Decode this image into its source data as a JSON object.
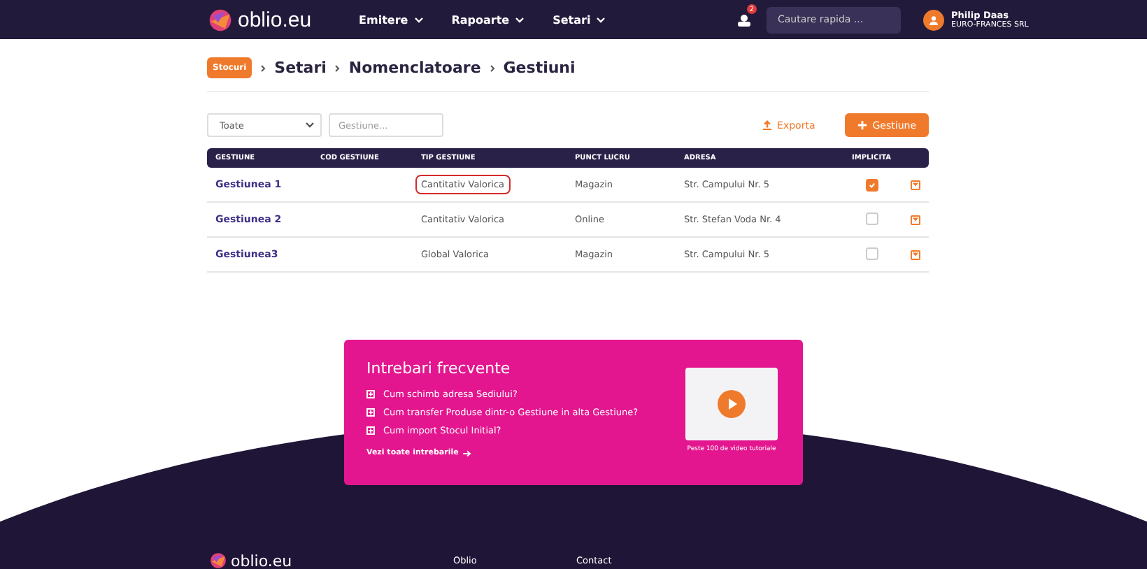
{
  "header": {
    "logo": "oblio.eu",
    "nav": [
      {
        "label": "Emitere"
      },
      {
        "label": "Rapoarte"
      },
      {
        "label": "Setari"
      }
    ],
    "notifications": "2",
    "search": {
      "placeholder": "Cautare rapida ..."
    },
    "user": {
      "name": "Philip Daas",
      "company": "EURO-FRANCES SRL"
    }
  },
  "breadcrumb": {
    "badge": "Stocuri",
    "items": [
      "Setari",
      "Nomenclatoare",
      "Gestiuni"
    ]
  },
  "toolbar": {
    "filter": "Toate",
    "search": {
      "placeholder": "Gestiune..."
    },
    "export": "Exporta",
    "add": "Gestiune"
  },
  "table": {
    "columns": [
      "GESTIUNE",
      "COD GESTIUNE",
      "TIP GESTIUNE",
      "PUNCT LUCRU",
      "ADRESA",
      "IMPLICITA"
    ],
    "rows": [
      {
        "name": "Gestiunea 1",
        "type": "Cantitativ Valorica",
        "highlighted": true,
        "location": "Magazin",
        "address": "Str. Campului Nr. 5",
        "checked": true
      },
      {
        "name": "Gestiunea 2",
        "type": "Cantitativ Valorica",
        "highlighted": false,
        "location": "Online",
        "address": "Str. Stefan Voda Nr. 4",
        "checked": false
      },
      {
        "name": "Gestiunea3",
        "type": "Global Valorica",
        "highlighted": false,
        "location": "Magazin",
        "address": "Str. Campului Nr. 5",
        "checked": false
      }
    ]
  },
  "faq": {
    "title": "Intrebari frecvente",
    "questions": [
      "Cum schimb adresa Sediului?",
      "Cum transfer Produse dintr-o Gestiune in alta Gestiune?",
      "Cum import Stocul Initial?"
    ],
    "all_link": "Vezi toate intrebarile",
    "video_caption": "Peste 100 de video tutoriale"
  },
  "footer": {
    "logo": "oblio.eu",
    "columns": [
      "Oblio",
      "Contact"
    ]
  }
}
